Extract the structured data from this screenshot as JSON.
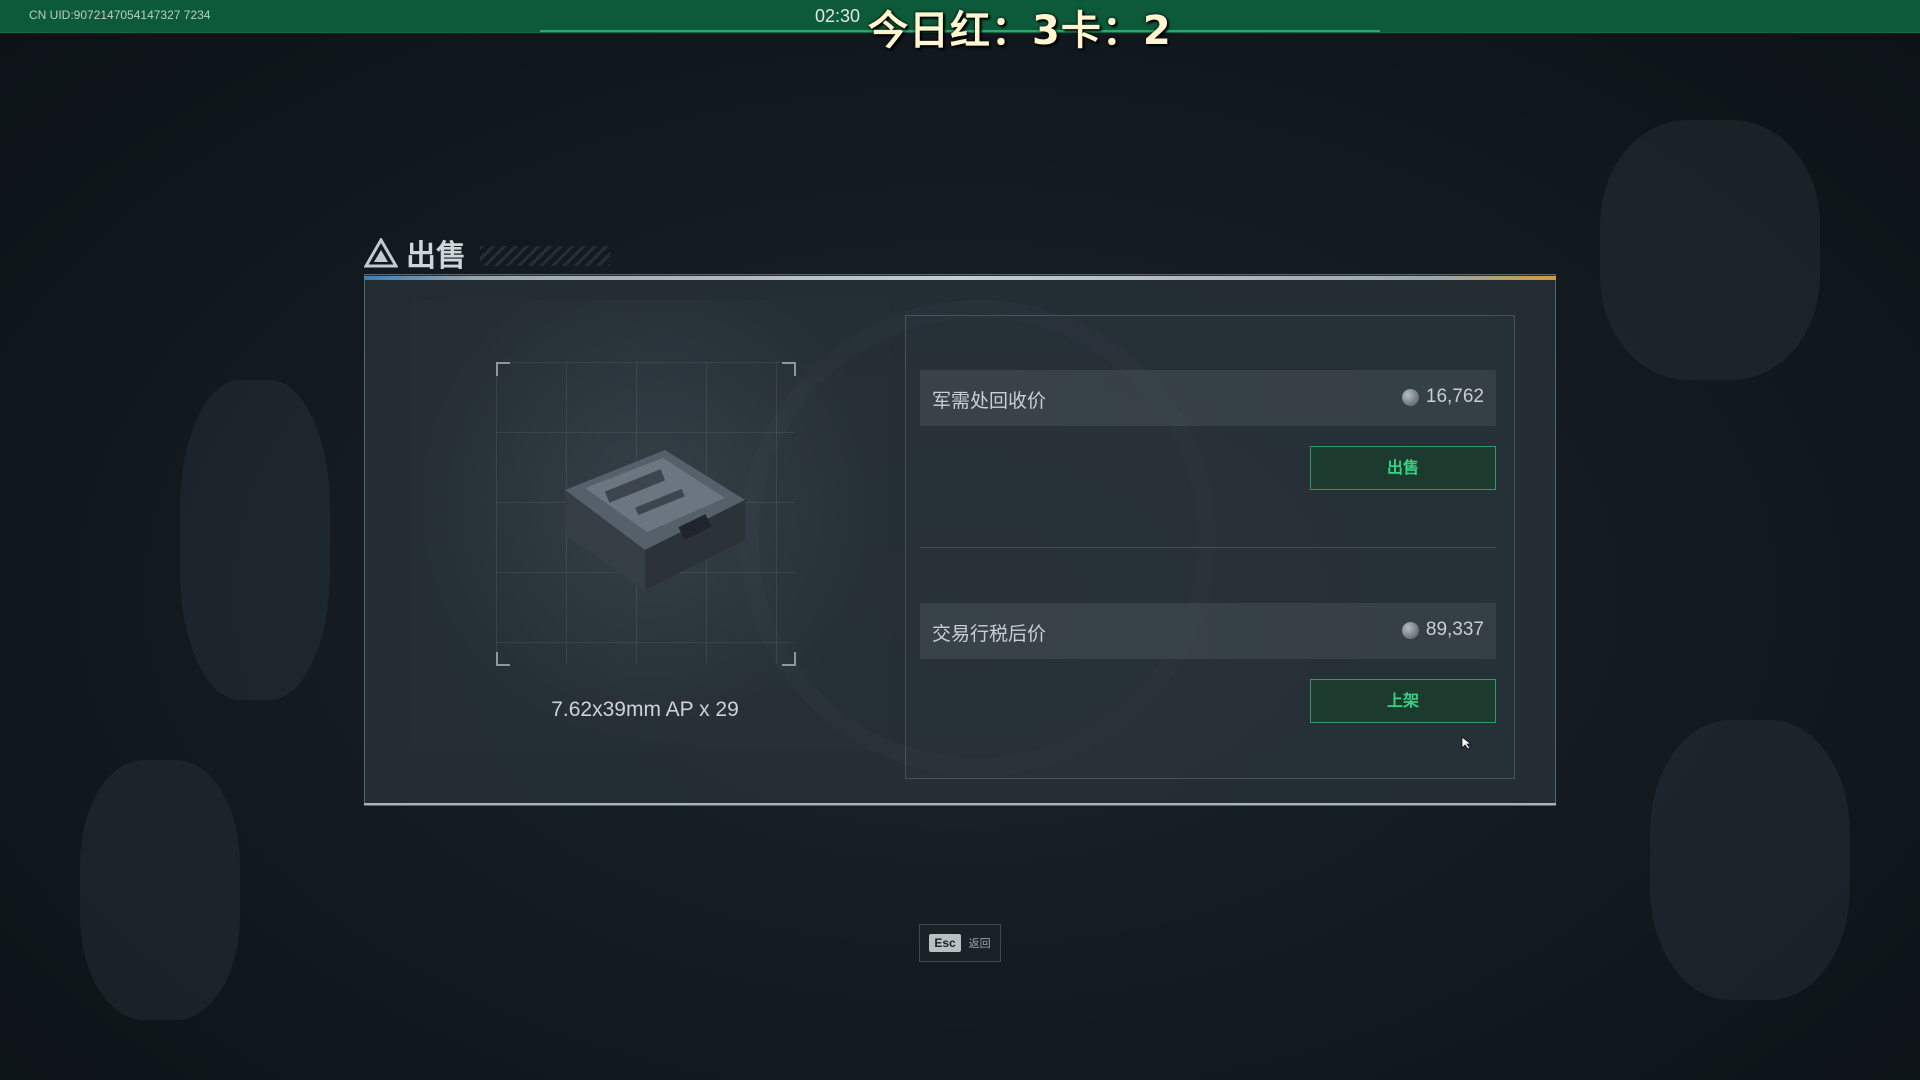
{
  "topbar": {
    "uid": "CN UID:9072147054147327 7234",
    "clock": "02:30",
    "overlay_text": "今日红：3卡：2"
  },
  "dialog": {
    "title": "出售",
    "item_name": "7.62x39mm AP x 29",
    "recycle": {
      "label": "军需处回收价",
      "price": "16,762",
      "button": "出售"
    },
    "market": {
      "label": "交易行税后价",
      "price": "89,337",
      "button": "上架"
    }
  },
  "footer": {
    "esc_key": "Esc",
    "esc_label": "返回"
  },
  "colors": {
    "topbar": "#0d5a3a",
    "accent_green": "#37d184",
    "button_bg": "#1d3a2f"
  }
}
